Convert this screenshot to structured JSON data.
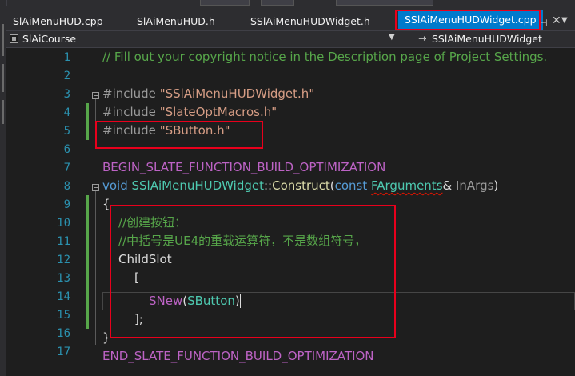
{
  "tabs": [
    {
      "label": "SlAiMenuHUD.cpp",
      "active": false
    },
    {
      "label": "SlAiMenuHUD.h",
      "active": false
    },
    {
      "label": "SSlAiMenuHUDWidget.h",
      "active": false
    },
    {
      "label": "SSlAiMenuHUDWidget.cpp",
      "active": true
    }
  ],
  "tab_controls": {
    "pin": "⊣",
    "close": "✕",
    "dropdown": "▼"
  },
  "navigation": {
    "scope": "SlAiCourse",
    "member_arrow": "→",
    "member": "SSlAiMenuHUDWidget"
  },
  "editor": {
    "line_numbers": [
      "1",
      "2",
      "3",
      "4",
      "5",
      "6",
      "7",
      "8",
      "9",
      "10",
      "11",
      "12",
      "13",
      "14",
      "15",
      "16",
      "17"
    ],
    "lines": {
      "l1": "// Fill out your copyright notice in the Description page of Project Settings.",
      "l3a": "#include ",
      "l3b": "\"SSlAiMenuHUDWidget.h\"",
      "l4a": "#include ",
      "l4b": "\"SlateOptMacros.h\"",
      "l5a": "#include ",
      "l5b": "\"SButton.h\"",
      "l7": "BEGIN_SLATE_FUNCTION_BUILD_OPTIMIZATION",
      "l8a": "void ",
      "l8b": "SSlAiMenuHUDWidget",
      "l8c": "::",
      "l8d": "Construct",
      "l8e": "(",
      "l8f": "const ",
      "l8g": "FArguments",
      "l8h": "& ",
      "l8i": "InArgs",
      "l8j": ")",
      "l9": "{",
      "l10": "//创建按钮：",
      "l11": "//中括号是UE4的重载运算符，不是数组符号，",
      "l12": "ChildSlot",
      "l13": "[",
      "l14a": "SNew",
      "l14b": "(",
      "l14c": "SButton",
      "l14d": ")",
      "l15": "];",
      "l16": "}",
      "l17": "END_SLATE_FUNCTION_BUILD_OPTIMIZATION"
    }
  },
  "colors": {
    "background": "#1e1e1e",
    "comment": "#57a64a",
    "keyword": "#569cd6",
    "type": "#4ec9b0",
    "string": "#d69d85",
    "macro": "#bd63c5",
    "active_tab": "#007acc",
    "annotation_box": "#e8001c"
  }
}
